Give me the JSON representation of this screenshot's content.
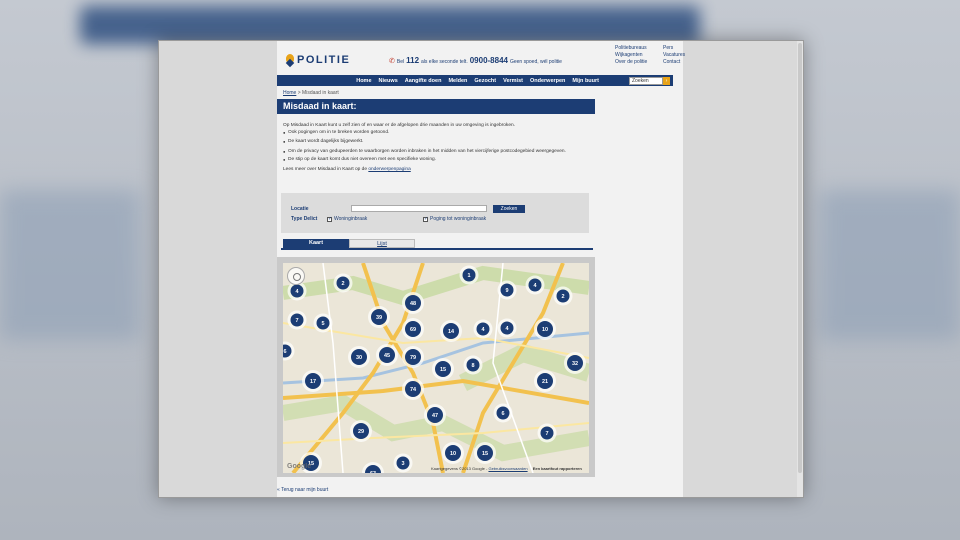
{
  "header": {
    "logo_text": "POLITIE",
    "emergency": {
      "pre": "Bel",
      "number_112": "112",
      "mid": "als elke seconde telt.",
      "number_general": "0900-8844",
      "post": "Geen spoed, wél politie"
    },
    "toplinks": [
      "Politiebureaus",
      "Pers",
      "Wijkagenten",
      "Vacatures",
      "Over de politie",
      "Contact"
    ]
  },
  "nav": {
    "items": [
      "Home",
      "Nieuws",
      "Aangifte doen",
      "Melden",
      "Gezocht",
      "Vermist",
      "Onderwerpen",
      "Mijn buurt"
    ],
    "search_placeholder": "Zoeken"
  },
  "breadcrumb": {
    "home": "Home",
    "separator": ">",
    "current": "Misdaad in kaart"
  },
  "page_title": "Misdaad in kaart:",
  "intro": {
    "paragraph": "Op Misdaad in Kaart kunt u zelf zien of en waar er de afgelopen drie maanden in uw omgeving is ingebroken.",
    "bullets_1": [
      "Ook pogingen om in te breken worden getoond."
    ],
    "bullets_2": [
      "De kaart wordt dagelijks bijgewerkt."
    ],
    "bullets_3": [
      "Om de privacy van gedupeerden te waarborgen worden inbraken in het midden van het viercijferige postcodegebied weergegeven.",
      "De stip op de kaart komt dus niet overeen met een specifieke woning."
    ],
    "more_text": "Lees meer over Misdaad in Kaart op de",
    "more_link": "onderwerpenpagina"
  },
  "filter": {
    "location_label": "Locatie",
    "location_value": "",
    "search_button": "Zoeken",
    "type_label": "Type Delict",
    "options": [
      {
        "label": "Woninginbraak",
        "checked": true
      },
      {
        "label": "Poging tot woninginbraak",
        "checked": true
      }
    ]
  },
  "tabs": {
    "map": "Kaart",
    "list": "Lijst"
  },
  "map": {
    "google": "Google",
    "attribution": "Kaartgegevens ©2013 Google -",
    "terms_link": "Gebruiksvoorwaarden",
    "report_link": "Een kaartfout rapporteren",
    "clusters": [
      {
        "label": "1"
      },
      {
        "label": "2"
      },
      {
        "label": "9"
      },
      {
        "label": "4"
      },
      {
        "label": "2"
      },
      {
        "label": "4"
      },
      {
        "label": "39"
      },
      {
        "label": "48"
      },
      {
        "label": "7"
      },
      {
        "label": "5"
      },
      {
        "label": "4"
      },
      {
        "label": "4"
      },
      {
        "label": "69"
      },
      {
        "label": "14"
      },
      {
        "label": "6"
      },
      {
        "label": "10"
      },
      {
        "label": "30"
      },
      {
        "label": "45"
      },
      {
        "label": "79"
      },
      {
        "label": "8"
      },
      {
        "label": "32"
      },
      {
        "label": "17"
      },
      {
        "label": "15"
      },
      {
        "label": "21"
      },
      {
        "label": "74"
      },
      {
        "label": "6"
      },
      {
        "label": "47"
      },
      {
        "label": "29"
      },
      {
        "label": "7"
      },
      {
        "label": "10"
      },
      {
        "label": "15"
      },
      {
        "label": "15"
      },
      {
        "label": "3"
      },
      {
        "label": "63"
      }
    ]
  },
  "footer": {
    "back_link": "« Terug naar mijn buurt"
  },
  "colors": {
    "brand": "#1c3d74",
    "accent": "#e8a319",
    "cluster": "#1c3d74"
  }
}
